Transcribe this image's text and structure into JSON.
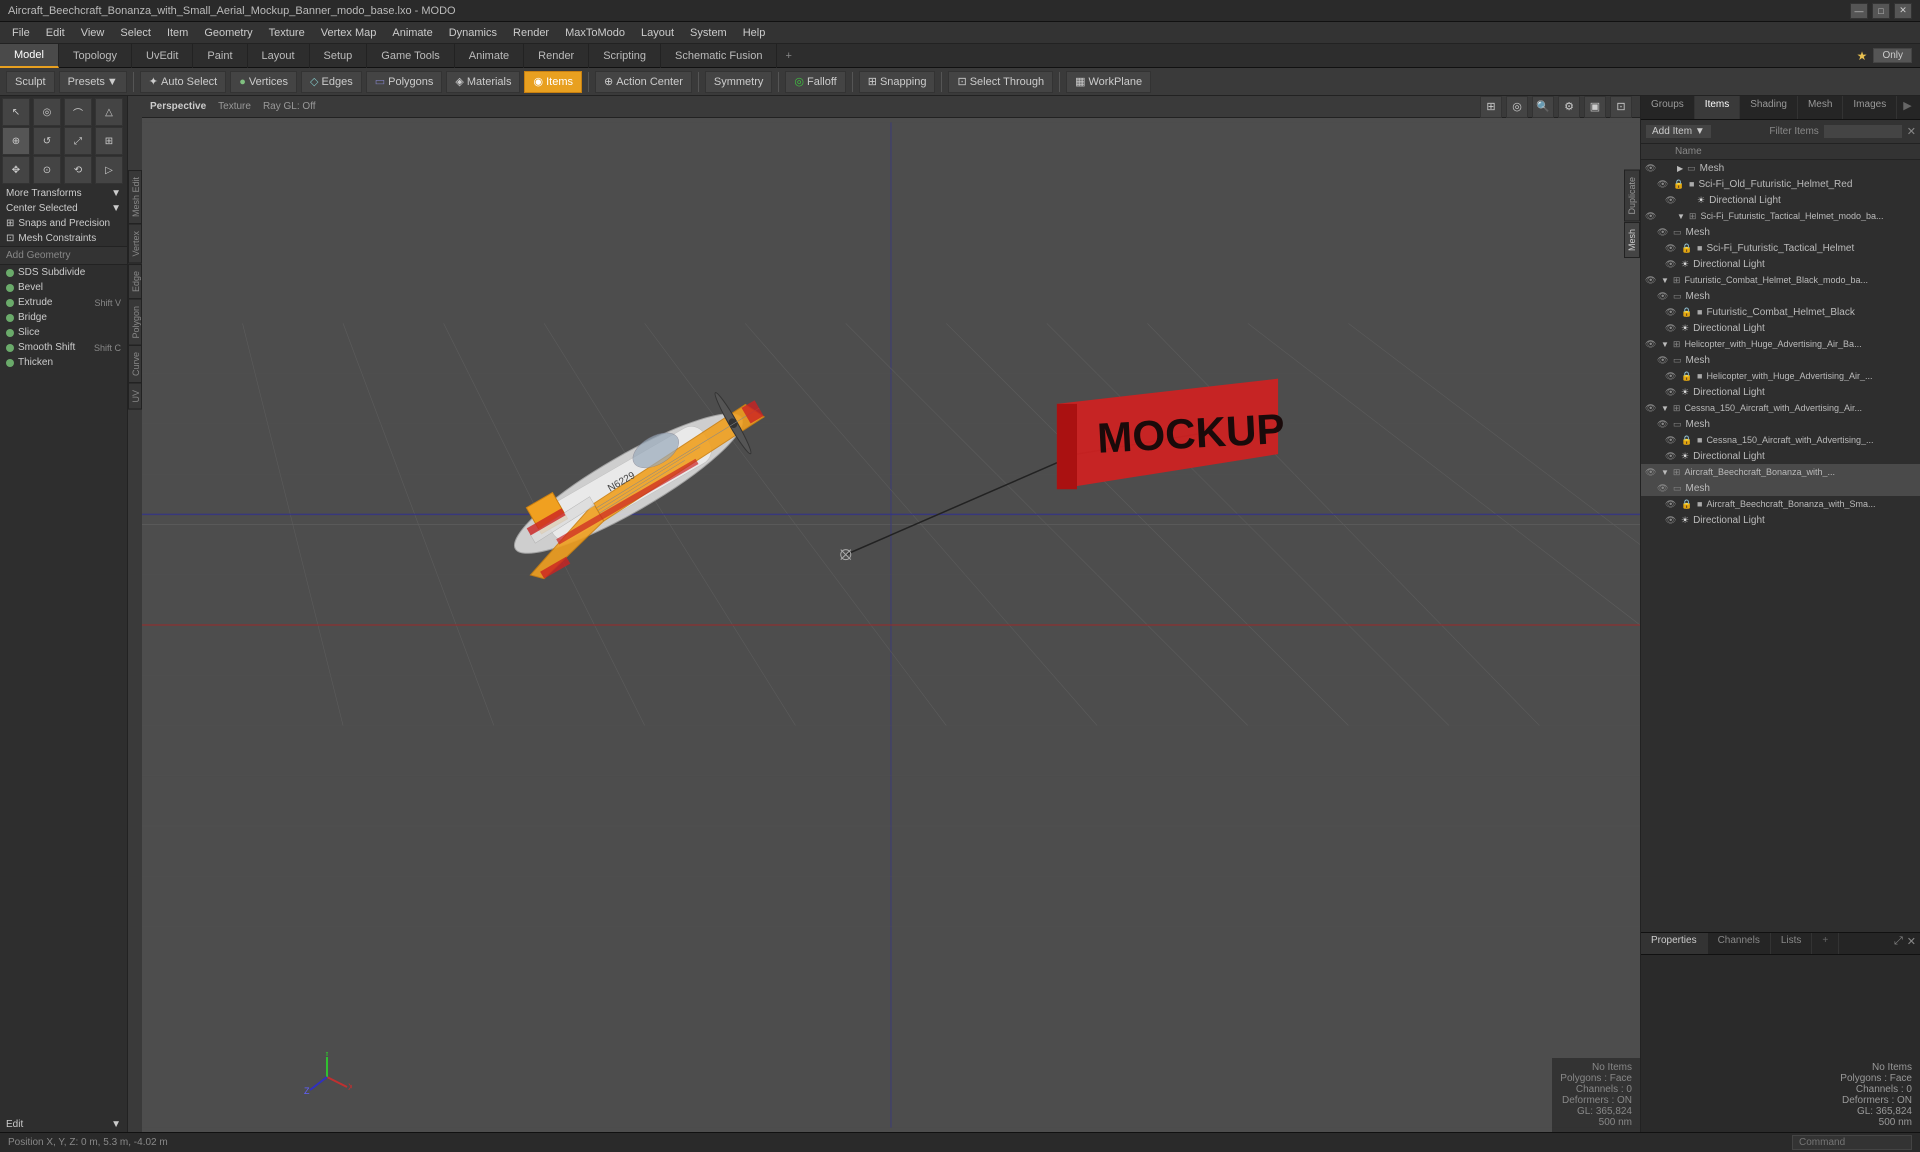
{
  "titlebar": {
    "title": "Aircraft_Beechcraft_Bonanza_with_Small_Aerial_Mockup_Banner_modo_base.lxo - MODO",
    "minimize": "—",
    "maximize": "□",
    "close": "✕"
  },
  "menubar": {
    "items": [
      "File",
      "Edit",
      "View",
      "Select",
      "Item",
      "Geometry",
      "Texture",
      "Vertex Map",
      "Animate",
      "Dynamics",
      "Render",
      "MaxToModo",
      "Layout",
      "System",
      "Help"
    ]
  },
  "tabbar": {
    "tabs": [
      "Model",
      "Topology",
      "UvEdit",
      "Paint",
      "Layout",
      "Setup",
      "Game Tools",
      "Animate",
      "Render",
      "Scripting",
      "Schematic Fusion"
    ],
    "active": "Model",
    "plus": "+",
    "only_label": "Only"
  },
  "toolbar": {
    "sculpt_label": "Sculpt",
    "presets_label": "Presets",
    "autoselect_label": "Auto Select",
    "vertices_label": "Vertices",
    "edges_label": "Edges",
    "polygons_label": "Polygons",
    "materials_label": "Materials",
    "items_label": "Items",
    "action_center_label": "Action Center",
    "symmetry_label": "Symmetry",
    "falloff_label": "Falloff",
    "snapping_label": "Snapping",
    "select_through_label": "Select Through",
    "workplane_label": "WorkPlane"
  },
  "left_panel": {
    "transform_tools": [
      "●",
      "○",
      "↔",
      "△",
      "⊕",
      "⊗",
      "↺",
      "⟳",
      "⤢",
      "⤡",
      "⊞",
      "⊟"
    ],
    "more_transforms": "More Transforms",
    "center_selected": "Center Selected",
    "snaps_precision": "Snaps and Precision",
    "mesh_constraints": "Mesh Constraints",
    "add_geometry": "Add Geometry",
    "geometry_tools": [
      {
        "name": "SDS Subdivide",
        "shortcut": ""
      },
      {
        "name": "Bevel",
        "shortcut": ""
      },
      {
        "name": "Extrude",
        "shortcut": "Shift V"
      },
      {
        "name": "Bridge",
        "shortcut": ""
      },
      {
        "name": "Slice",
        "shortcut": ""
      },
      {
        "name": "Smooth Shift",
        "shortcut": "Shift C"
      },
      {
        "name": "Thicken",
        "shortcut": ""
      }
    ],
    "edit_label": "Edit"
  },
  "viewport": {
    "view_type": "Perspective",
    "texture": "Texture",
    "ray_gl": "Ray GL: Off"
  },
  "viewport_info": {
    "no_items": "No Items",
    "polygons": "Polygons : Face",
    "channels": "Channels : 0",
    "deformers": "Deformers : ON",
    "gl": "GL: 365,824",
    "gl2": "500 nm"
  },
  "statusbar": {
    "position": "Position X, Y, Z:  0 m, 5.3 m, -4.02 m",
    "command": "Command"
  },
  "right_panel_top": {
    "tabs": [
      "Groups",
      "Items",
      "Shading",
      "Mesh",
      "Images"
    ],
    "active": "Items",
    "add_item_label": "Add Item",
    "filter_label": "Filter Items",
    "name_col": "Name"
  },
  "item_list": [
    {
      "level": 1,
      "type": "mesh",
      "name": "Mesh",
      "visible": true
    },
    {
      "level": 2,
      "type": "item",
      "name": "Sci-Fi_Old_Futuristic_Helmet_Red",
      "visible": true
    },
    {
      "level": 2,
      "type": "light",
      "name": "Directional Light",
      "visible": true
    },
    {
      "level": 1,
      "type": "group",
      "name": "Sci-Fi_Futuristic_Tactical_Helmet_modo_ba...",
      "visible": true
    },
    {
      "level": 2,
      "type": "mesh",
      "name": "Mesh",
      "visible": true
    },
    {
      "level": 2,
      "type": "item",
      "name": "Sci-Fi_Futuristic_Tactical_Helmet",
      "visible": true
    },
    {
      "level": 2,
      "type": "light",
      "name": "Directional Light",
      "visible": true
    },
    {
      "level": 1,
      "type": "group",
      "name": "Futuristic_Combat_Helmet_Black_modo_ba...",
      "visible": true
    },
    {
      "level": 2,
      "type": "mesh",
      "name": "Mesh",
      "visible": true
    },
    {
      "level": 2,
      "type": "item",
      "name": "Futuristic_Combat_Helmet_Black",
      "visible": true
    },
    {
      "level": 2,
      "type": "light",
      "name": "Directional Light",
      "visible": true
    },
    {
      "level": 1,
      "type": "group",
      "name": "Helicopter_with_Huge_Advertising_Air_Ba...",
      "visible": true
    },
    {
      "level": 2,
      "type": "mesh",
      "name": "Mesh",
      "visible": true
    },
    {
      "level": 2,
      "type": "item",
      "name": "Helicopter_with_Huge_Advertising_Air_...",
      "visible": true
    },
    {
      "level": 2,
      "type": "light",
      "name": "Directional Light",
      "visible": true
    },
    {
      "level": 1,
      "type": "group",
      "name": "Cessna_150_Aircraft_with_Advertising_Air...",
      "visible": true
    },
    {
      "level": 2,
      "type": "mesh",
      "name": "Mesh",
      "visible": true
    },
    {
      "level": 2,
      "type": "item",
      "name": "Cessna_150_Aircraft_with_Advertising_...",
      "visible": true
    },
    {
      "level": 2,
      "type": "light",
      "name": "Directional Light",
      "visible": true
    },
    {
      "level": 1,
      "type": "group",
      "name": "Aircraft_Beechcraft_Bonanza_with_...",
      "visible": true,
      "selected": true
    },
    {
      "level": 2,
      "type": "mesh",
      "name": "Mesh",
      "visible": true
    },
    {
      "level": 2,
      "type": "item",
      "name": "Aircraft_Beechcraft_Bonanza_with_Sma...",
      "visible": true
    },
    {
      "level": 2,
      "type": "light",
      "name": "Directional Light",
      "visible": true
    }
  ],
  "bottom_right_tabs": [
    "Properties",
    "Channels",
    "Lists"
  ],
  "left_side_tabs": [
    "Mesh Edit",
    "Vertex",
    "Edge",
    "Polygon",
    "Curve",
    "UV"
  ],
  "right_side_tabs": [
    "Duplicate",
    "Mesh"
  ]
}
